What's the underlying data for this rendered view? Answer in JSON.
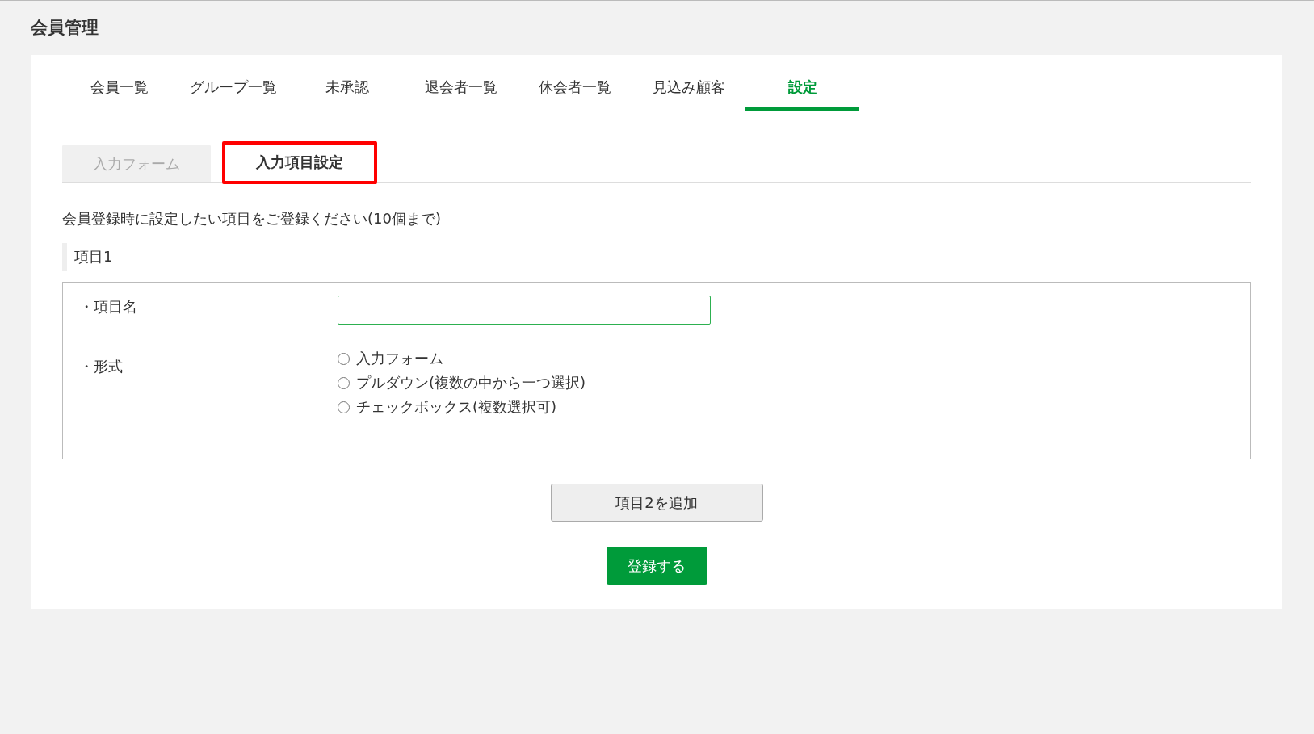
{
  "page_title": "会員管理",
  "tabs": [
    {
      "label": "会員一覧",
      "selected": false
    },
    {
      "label": "グループ一覧",
      "selected": false
    },
    {
      "label": "未承認",
      "selected": false
    },
    {
      "label": "退会者一覧",
      "selected": false
    },
    {
      "label": "休会者一覧",
      "selected": false
    },
    {
      "label": "見込み顧客",
      "selected": false
    },
    {
      "label": "設定",
      "selected": true
    }
  ],
  "subtabs": [
    {
      "label": "入力フォーム",
      "selected": false,
      "highlighted": false
    },
    {
      "label": "入力項目設定",
      "selected": true,
      "highlighted": true
    }
  ],
  "description": "会員登録時に設定したい項目をご登録ください(10個まで)",
  "item": {
    "heading": "項目1",
    "name_label": "・項目名",
    "format_label": "・形式",
    "options": [
      {
        "label": "入力フォーム",
        "selected": false
      },
      {
        "label": "プルダウン(複数の中から一つ選択)",
        "selected": false
      },
      {
        "label": "チェックボックス(複数選択可)",
        "selected": false
      }
    ]
  },
  "add_button": "項目2を追加",
  "submit_button": "登録する"
}
